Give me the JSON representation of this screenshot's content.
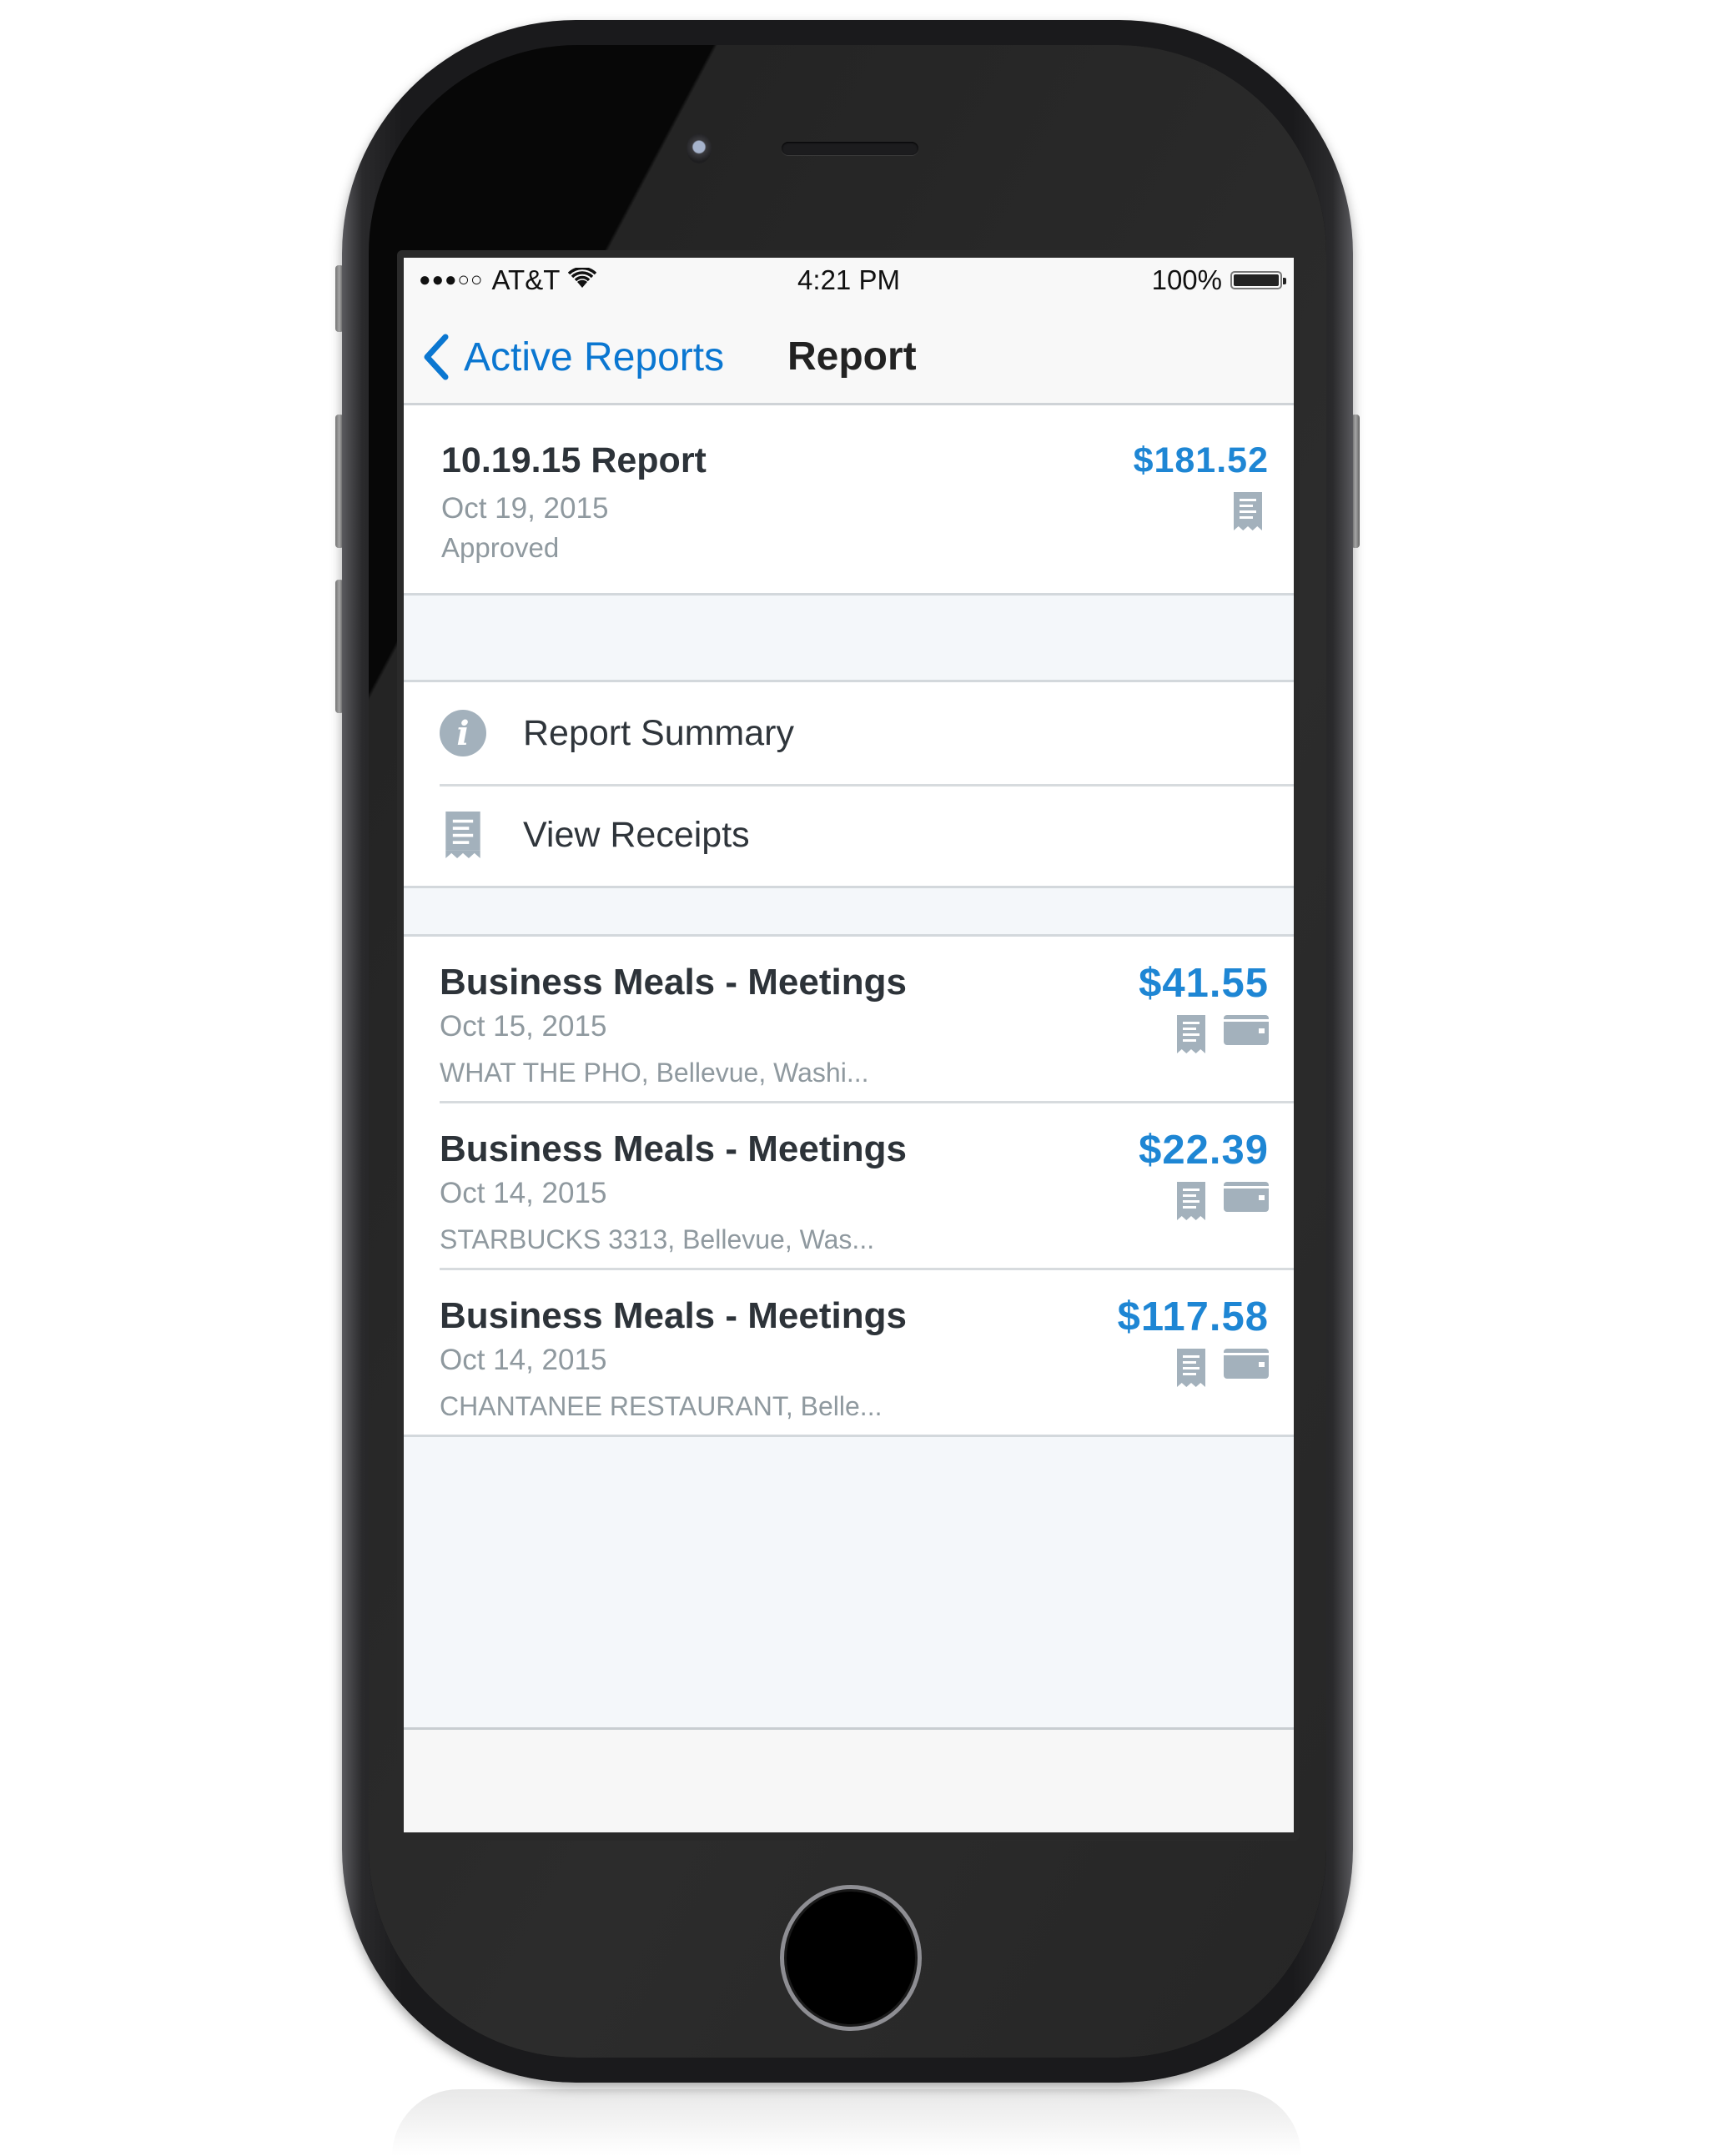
{
  "status_bar": {
    "signal": "●●●○○",
    "carrier": "AT&T",
    "wifi_icon": "wifi-icon",
    "time": "4:21 PM",
    "battery_percent": "100%",
    "battery_level": 1.0
  },
  "nav": {
    "back_label": "Active Reports",
    "title": "Report"
  },
  "report": {
    "name": "10.19.15 Report",
    "date": "Oct 19, 2015",
    "status": "Approved",
    "total": "$181.52",
    "icons": [
      "receipt-icon"
    ]
  },
  "menu": {
    "items": [
      {
        "label": "Report Summary",
        "icon": "info-icon"
      },
      {
        "label": "View Receipts",
        "icon": "receipt-icon"
      }
    ]
  },
  "expenses": [
    {
      "type": "Business Meals - Meetings",
      "date": "Oct 15, 2015",
      "merchant": "WHAT THE PHO, Bellevue, Washi...",
      "amount": "$41.55",
      "icons": [
        "receipt-icon",
        "credit-card-icon"
      ]
    },
    {
      "type": "Business Meals - Meetings",
      "date": "Oct 14, 2015",
      "merchant": "STARBUCKS 3313, Bellevue, Was...",
      "amount": "$22.39",
      "icons": [
        "receipt-icon",
        "credit-card-icon"
      ]
    },
    {
      "type": "Business Meals - Meetings",
      "date": "Oct 14, 2015",
      "merchant": "CHANTANEE RESTAURANT, Belle...",
      "amount": "$117.58",
      "icons": [
        "receipt-icon",
        "credit-card-icon"
      ]
    }
  ],
  "colors": {
    "accent_blue": "#1e86d4",
    "icon_gray": "#a3b1bc",
    "background": "#f4f7fa"
  }
}
